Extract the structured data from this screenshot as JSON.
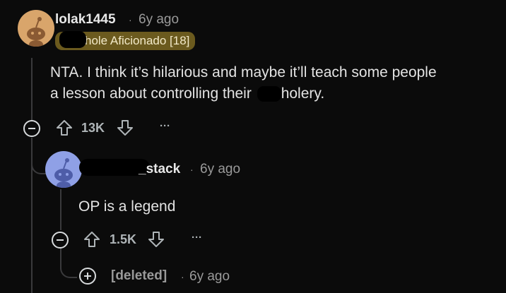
{
  "comments": [
    {
      "username": "lolak1445",
      "time": "6y ago",
      "separator": "·",
      "flair": "hole Aficionado [18]",
      "text_line1": "NTA. I think it’s hilarious and maybe it’ll teach some people",
      "text_line2a": "a lesson about controlling their",
      "text_line2b": "holery.",
      "votes": "13K",
      "more": "···",
      "avatar_color": "#d9a56b"
    },
    {
      "username": "_stack",
      "time": "6y ago",
      "separator": "·",
      "text": "OP is a legend",
      "votes": "1.5K",
      "more": "···",
      "avatar_color": "#8fa0e6"
    },
    {
      "username": "[deleted]",
      "separator": "·",
      "time": "6y ago"
    }
  ],
  "colors": {
    "background": "#0b0b0b",
    "flair": "#6b5a1e",
    "thread_line": "#3a3a3c"
  },
  "icons": [
    "collapse-icon",
    "upvote-icon",
    "downvote-icon",
    "more-icon",
    "expand-icon",
    "snoo-avatar-icon"
  ]
}
